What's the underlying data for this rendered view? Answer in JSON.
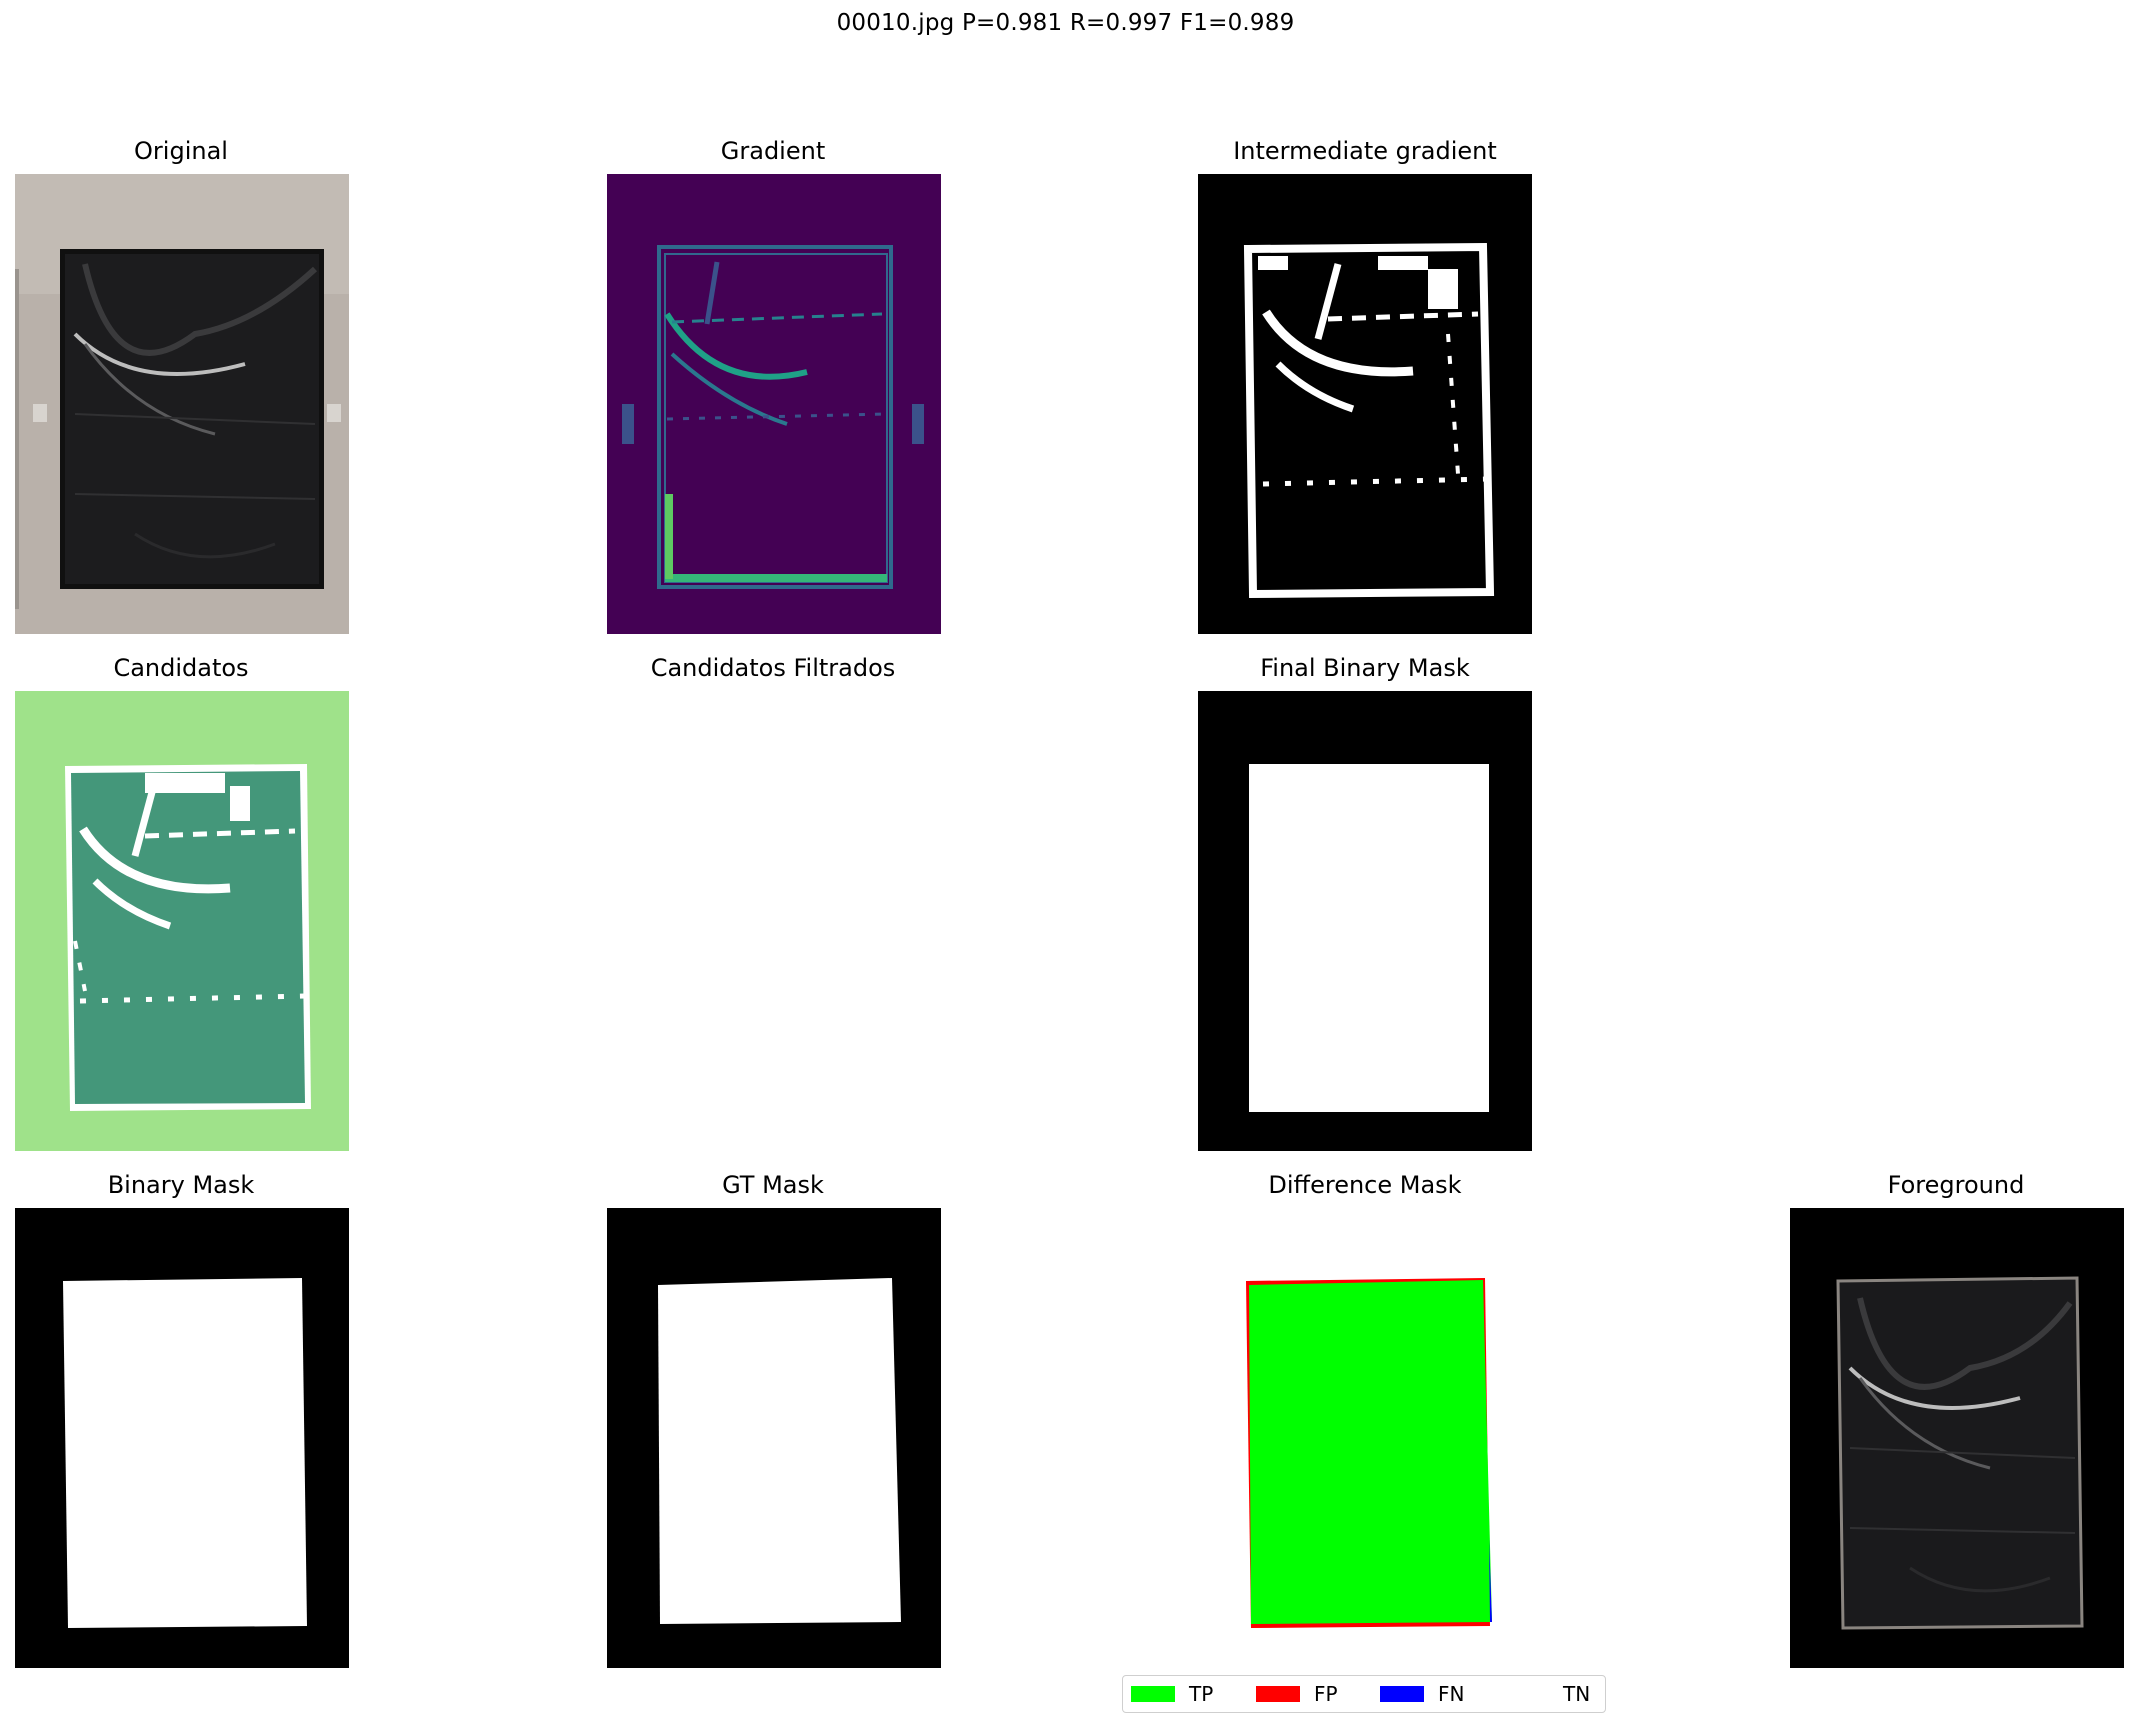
{
  "figure": {
    "suptitle": "00010.jpg  P=0.981 R=0.997 F1=0.989"
  },
  "panels": {
    "original": {
      "title": "Original"
    },
    "gradient": {
      "title": "Gradient"
    },
    "intermediate_gradient": {
      "title": "Intermediate gradient"
    },
    "candidatos": {
      "title": "Candidatos"
    },
    "candidatos_filtrados": {
      "title": "Candidatos Filtrados"
    },
    "final_binary_mask": {
      "title": "Final Binary Mask"
    },
    "binary_mask": {
      "title": "Binary Mask"
    },
    "gt_mask": {
      "title": "GT Mask"
    },
    "difference_mask": {
      "title": "Difference Mask"
    },
    "foreground": {
      "title": "Foreground"
    }
  },
  "legend": {
    "items": [
      {
        "label": "TP",
        "color": "#00ff00"
      },
      {
        "label": "FP",
        "color": "#ff0000"
      },
      {
        "label": "FN",
        "color": "#0000ff"
      },
      {
        "label": "TN",
        "color": "#ffffff"
      }
    ]
  },
  "colors": {
    "mask_background": "#000000",
    "mask_foreground": "#ffffff",
    "gradient_background": "#440154",
    "candidatos_background": "#9fe28a",
    "candidatos_fill": "#44977a"
  }
}
